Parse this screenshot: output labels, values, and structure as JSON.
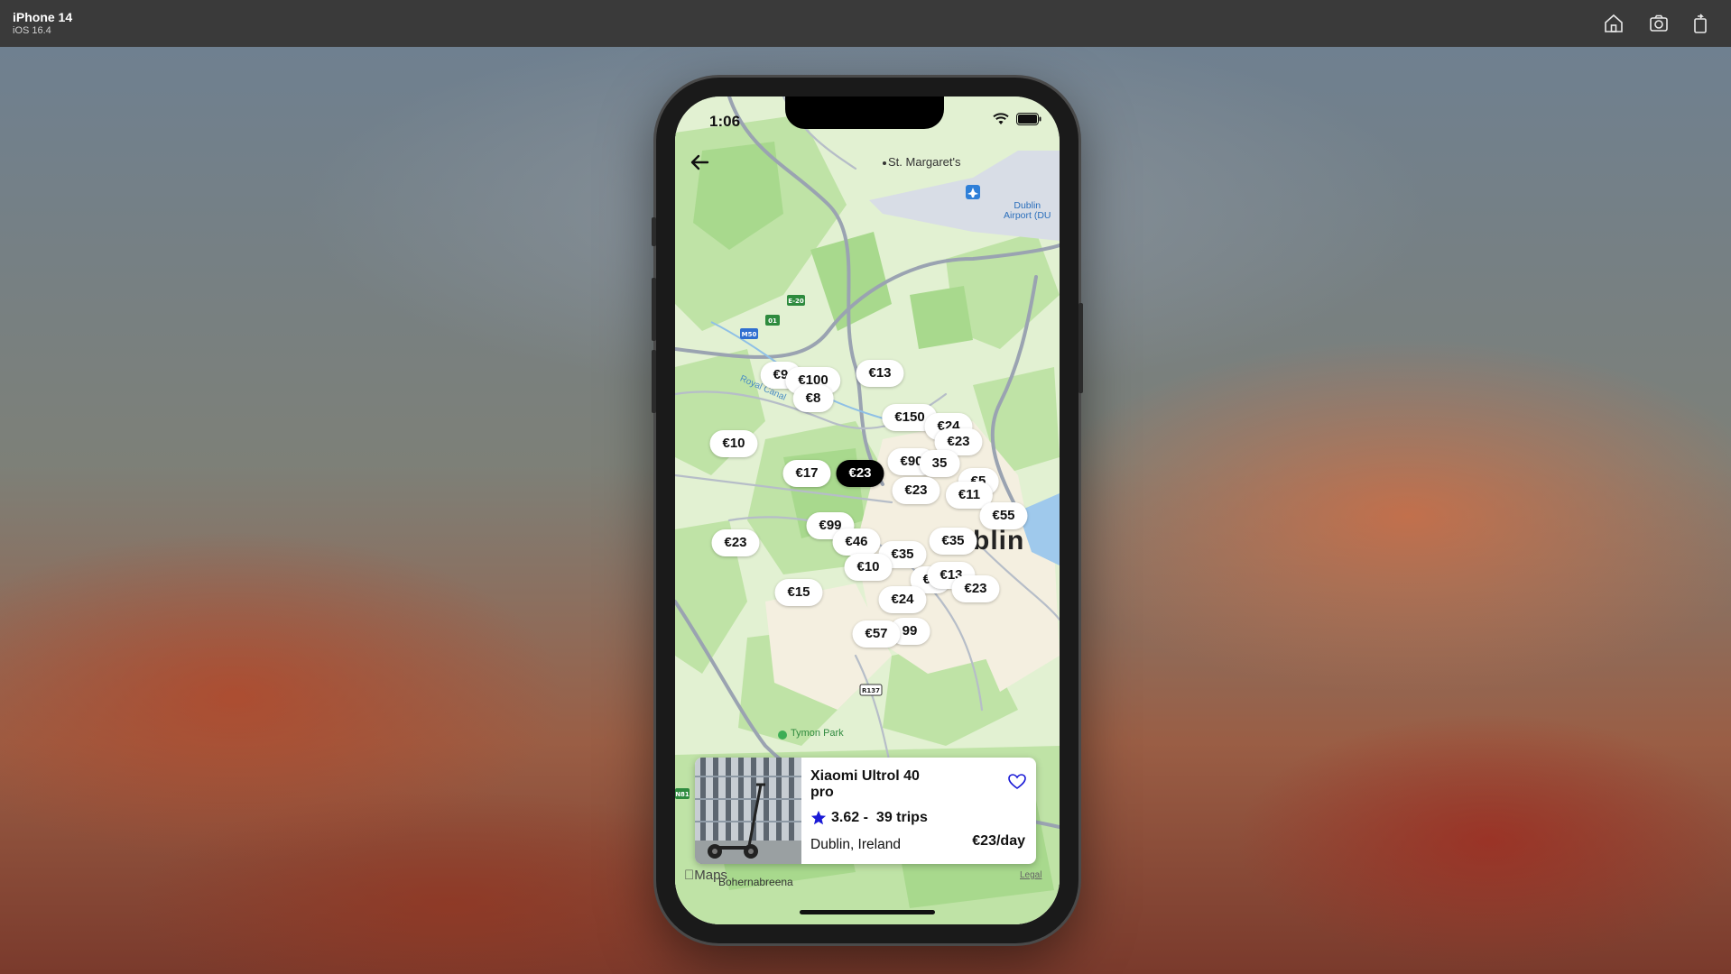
{
  "simulator": {
    "device": "iPhone 14",
    "os": "iOS 16.4",
    "buttons": [
      "home-icon",
      "screenshot-icon",
      "rotate-icon"
    ]
  },
  "status_bar": {
    "time": "1:06",
    "icons": [
      "wifi-icon",
      "battery-icon"
    ]
  },
  "map": {
    "places": {
      "st_margarets": "St. Margaret's",
      "airport_line1": "Dublin",
      "airport_line2": "Airport (DU",
      "royal_canal": "Royal Canal",
      "dublin": "Dublin",
      "tymon_park": "Tymon Park",
      "bohernabreena": "Bohernabreena"
    },
    "road_shields": [
      "E-20",
      "01",
      "M50",
      "R137",
      "N81",
      "M50"
    ],
    "price_pins": [
      {
        "label": "€9"
      },
      {
        "label": "€100"
      },
      {
        "label": "€13"
      },
      {
        "label": "€8"
      },
      {
        "label": "€150"
      },
      {
        "label": "€24"
      },
      {
        "label": "€23"
      },
      {
        "label": "€10"
      },
      {
        "label": "€90"
      },
      {
        "label": "35"
      },
      {
        "label": "€17"
      },
      {
        "label": "€23",
        "selected": true
      },
      {
        "label": "€5"
      },
      {
        "label": "€23"
      },
      {
        "label": "€11"
      },
      {
        "label": "€55"
      },
      {
        "label": "€99"
      },
      {
        "label": "€35"
      },
      {
        "label": "€23"
      },
      {
        "label": "€46"
      },
      {
        "label": "€35"
      },
      {
        "label": "€10"
      },
      {
        "label": "€3"
      },
      {
        "label": "€13"
      },
      {
        "label": "€23"
      },
      {
        "label": "€15"
      },
      {
        "label": "€24"
      },
      {
        "label": "99"
      },
      {
        "label": "€57"
      }
    ],
    "maps_logo": "Maps",
    "legal": "Legal"
  },
  "listing_card": {
    "title": "Xiaomi Ultrol 40 pro",
    "rating": "3.62 -",
    "trips": "39 trips",
    "location": "Dublin, Ireland",
    "price": "€23/day",
    "image_icon": "scooter-photo",
    "accent": "#1a1ad6"
  }
}
